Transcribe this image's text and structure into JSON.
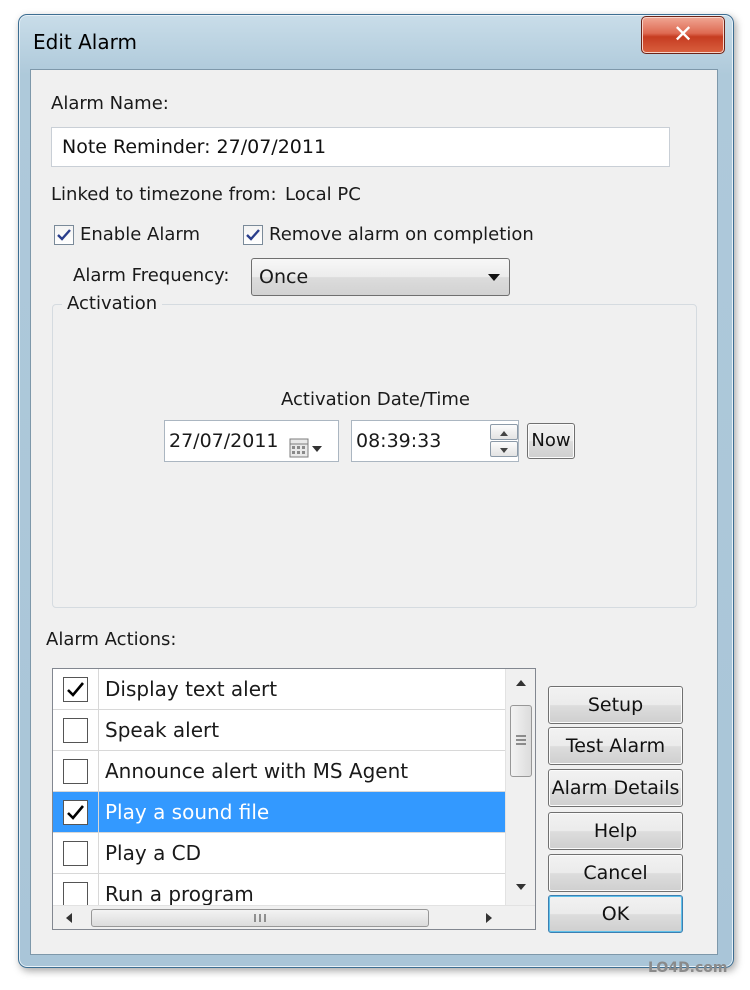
{
  "window": {
    "title": "Edit Alarm",
    "close_glyph": "✕"
  },
  "alarm_name": {
    "label": "Alarm Name:",
    "value": "Note Reminder: 27/07/2011"
  },
  "timezone": {
    "label": "Linked to timezone from:",
    "value": "Local PC"
  },
  "options": {
    "enable_alarm": {
      "label": "Enable Alarm",
      "checked": true
    },
    "remove_on_completion": {
      "label": "Remove alarm on completion",
      "checked": true
    }
  },
  "frequency": {
    "label": "Alarm Frequency:",
    "selected": "Once"
  },
  "activation": {
    "group_title": "Activation",
    "datetime_label": "Activation Date/Time",
    "date": "27/07/2011",
    "time": "08:39:33",
    "now_button": "Now"
  },
  "actions": {
    "label": "Alarm Actions:",
    "items": [
      {
        "label": "Display text alert",
        "checked": true,
        "selected": false
      },
      {
        "label": "Speak alert",
        "checked": false,
        "selected": false
      },
      {
        "label": "Announce alert with MS Agent",
        "checked": false,
        "selected": false
      },
      {
        "label": "Play a sound file",
        "checked": true,
        "selected": true
      },
      {
        "label": "Play a CD",
        "checked": false,
        "selected": false
      },
      {
        "label": "Run a program",
        "checked": false,
        "selected": false
      }
    ]
  },
  "buttons": {
    "setup": "Setup",
    "test_alarm": "Test Alarm",
    "alarm_details": "Alarm Details",
    "help": "Help",
    "cancel": "Cancel",
    "ok": "OK"
  },
  "watermark": "LO4D.com",
  "colors": {
    "selection": "#3399ff",
    "close_button": "#c63c21"
  }
}
